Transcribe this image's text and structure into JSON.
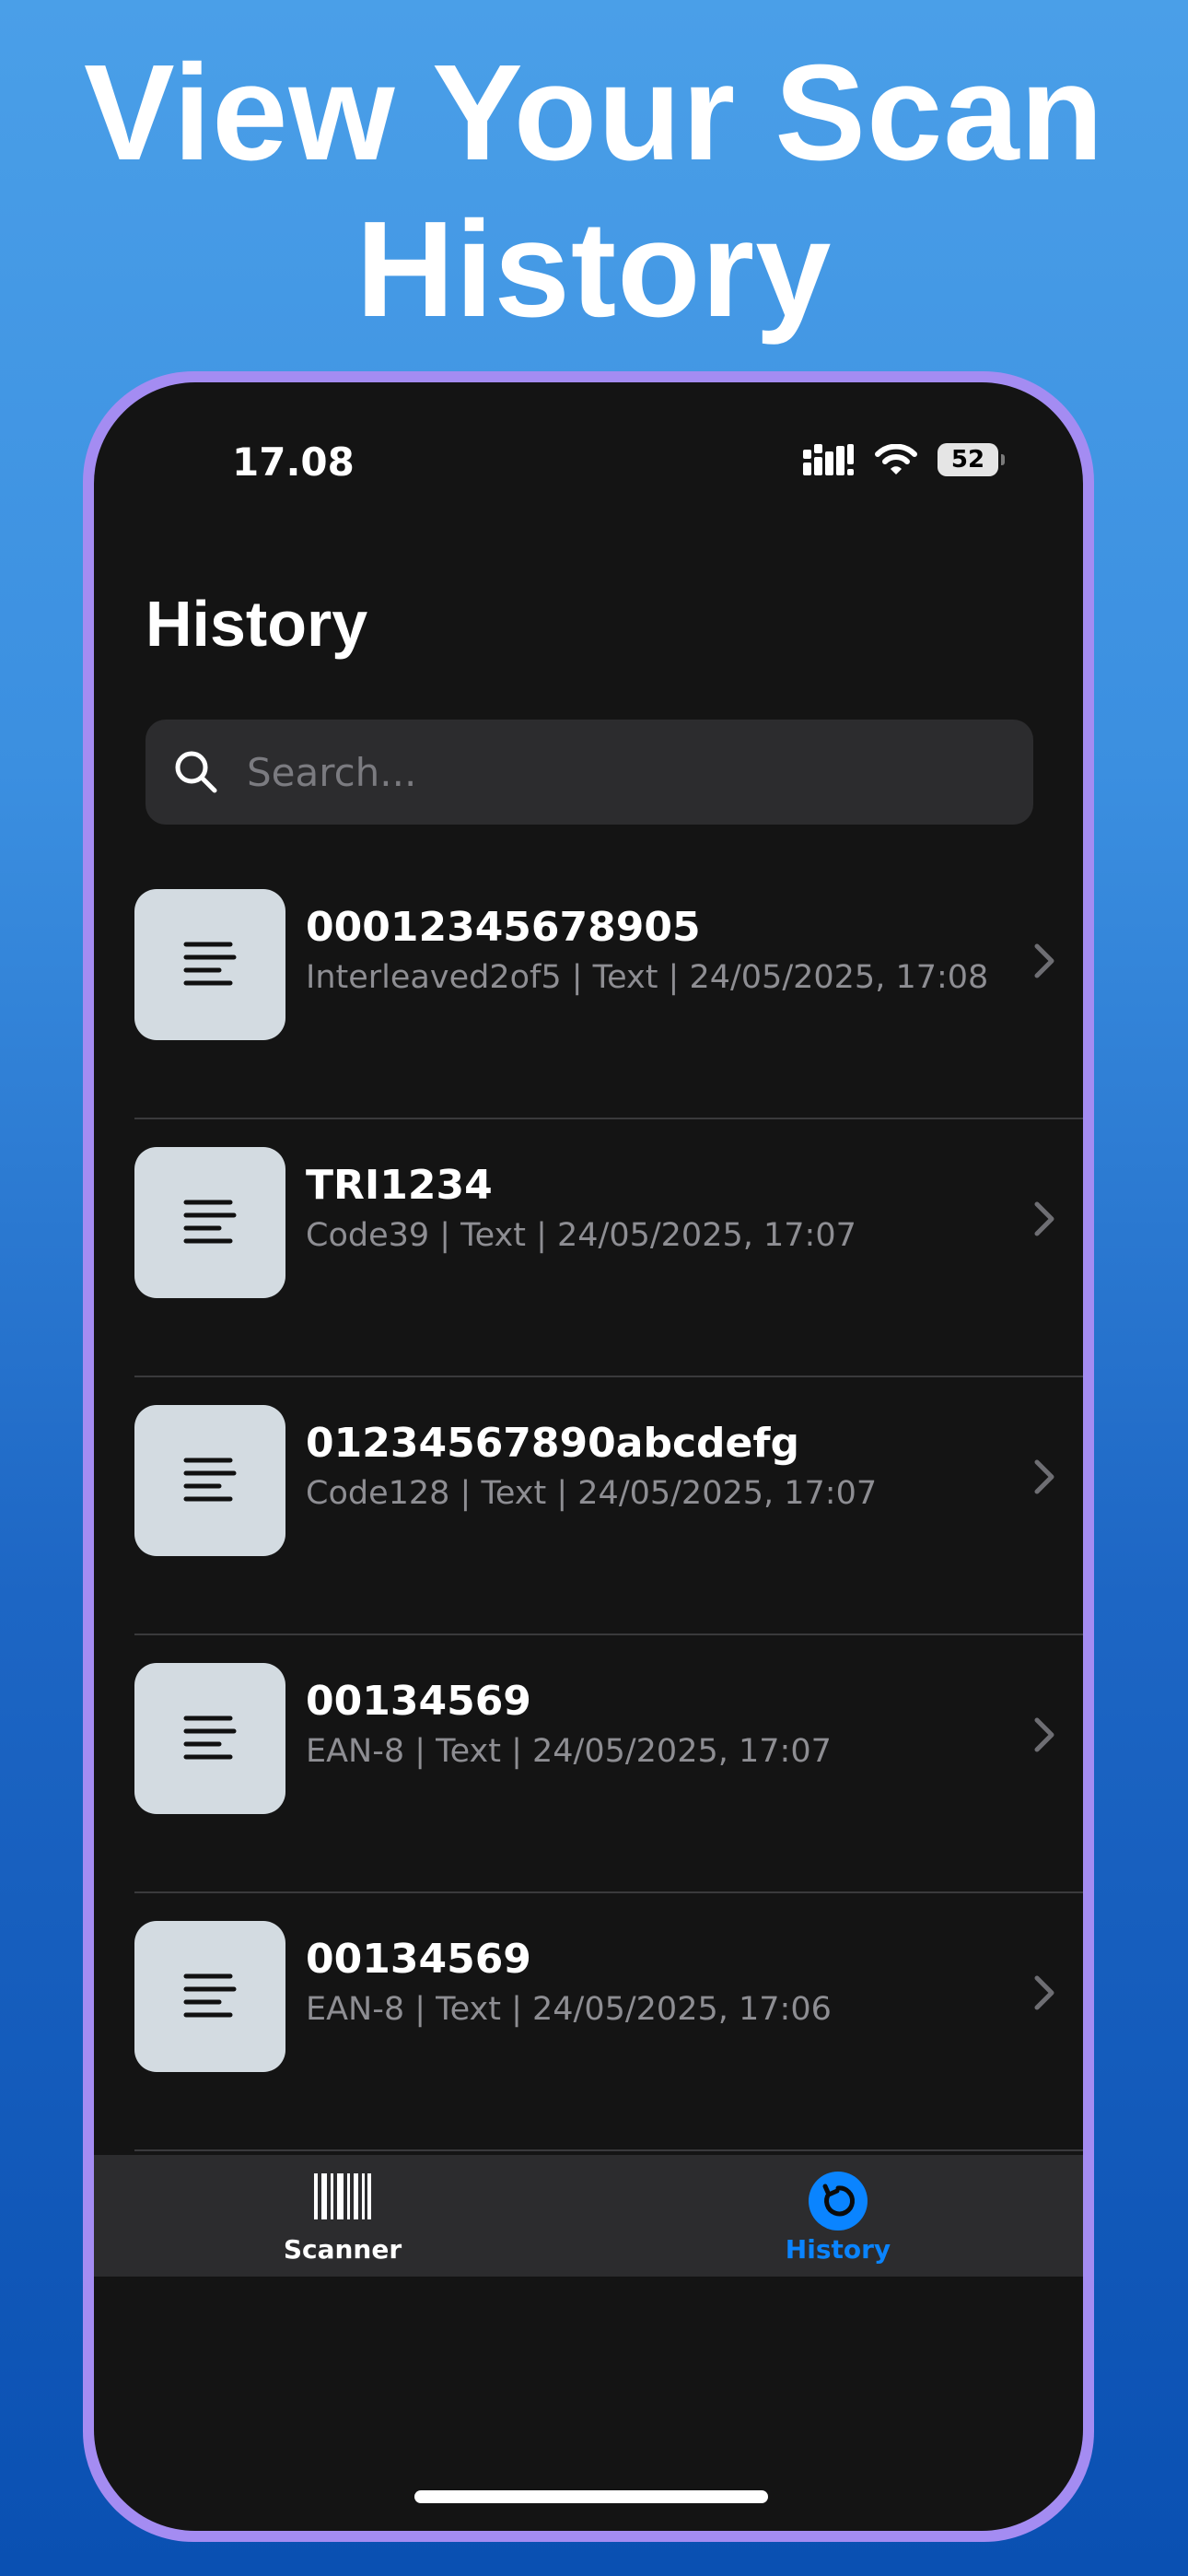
{
  "headline": {
    "line1": "View Your Scan",
    "line2": "History"
  },
  "status_bar": {
    "time": "17.08",
    "battery": "52"
  },
  "page": {
    "title": "History"
  },
  "search": {
    "placeholder": "Search..."
  },
  "history": [
    {
      "value": "00012345678905",
      "meta": "Interleaved2of5 | Text | 24/05/2025, 17:08"
    },
    {
      "value": "TRI1234",
      "meta": "Code39 | Text | 24/05/2025, 17:07"
    },
    {
      "value": "01234567890abcdefg",
      "meta": "Code128 | Text | 24/05/2025, 17:07"
    },
    {
      "value": "00134569",
      "meta": "EAN-8 | Text | 24/05/2025, 17:07"
    },
    {
      "value": "00134569",
      "meta": "EAN-8 | Text | 24/05/2025, 17:06"
    }
  ],
  "tabs": [
    {
      "label": "Scanner",
      "icon": "barcode-icon",
      "active": false
    },
    {
      "label": "History",
      "icon": "history-icon",
      "active": true
    }
  ],
  "colors": {
    "accent": "#0a84ff",
    "frame": "#a48cf2",
    "background_top": "#4a9fe8",
    "background_bottom": "#0a50b2"
  }
}
